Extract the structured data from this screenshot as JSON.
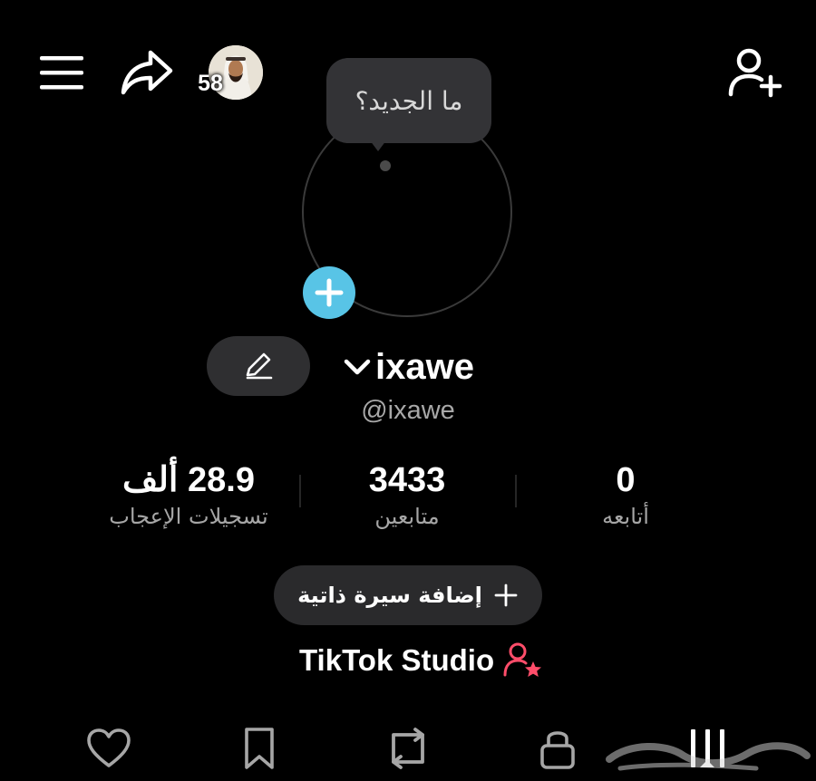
{
  "header": {
    "story_count": "58",
    "icons": [
      "menu-icon",
      "share-icon",
      "add-friend-icon"
    ]
  },
  "avatar": {
    "whats_new": "ما الجديد؟",
    "add_icon": "plus-icon",
    "add_color": "#58c4e6"
  },
  "profile": {
    "username": "ixawe",
    "handle": "@ixawe"
  },
  "stats": {
    "likes": {
      "value": "28.9 ألف",
      "label": "تسجيلات الإعجاب"
    },
    "followers": {
      "value": "3433",
      "label": "متابعين"
    },
    "following": {
      "value": "0",
      "label": "أتابعه"
    }
  },
  "bio": {
    "add_label": "إضافة سيرة ذاتية"
  },
  "studio": {
    "label": "TikTok Studio",
    "icon_color": "#ff4d6a"
  },
  "tabs": [
    "heart-icon",
    "bookmark-icon",
    "repost-icon",
    "lock-icon",
    "grid-icon"
  ]
}
